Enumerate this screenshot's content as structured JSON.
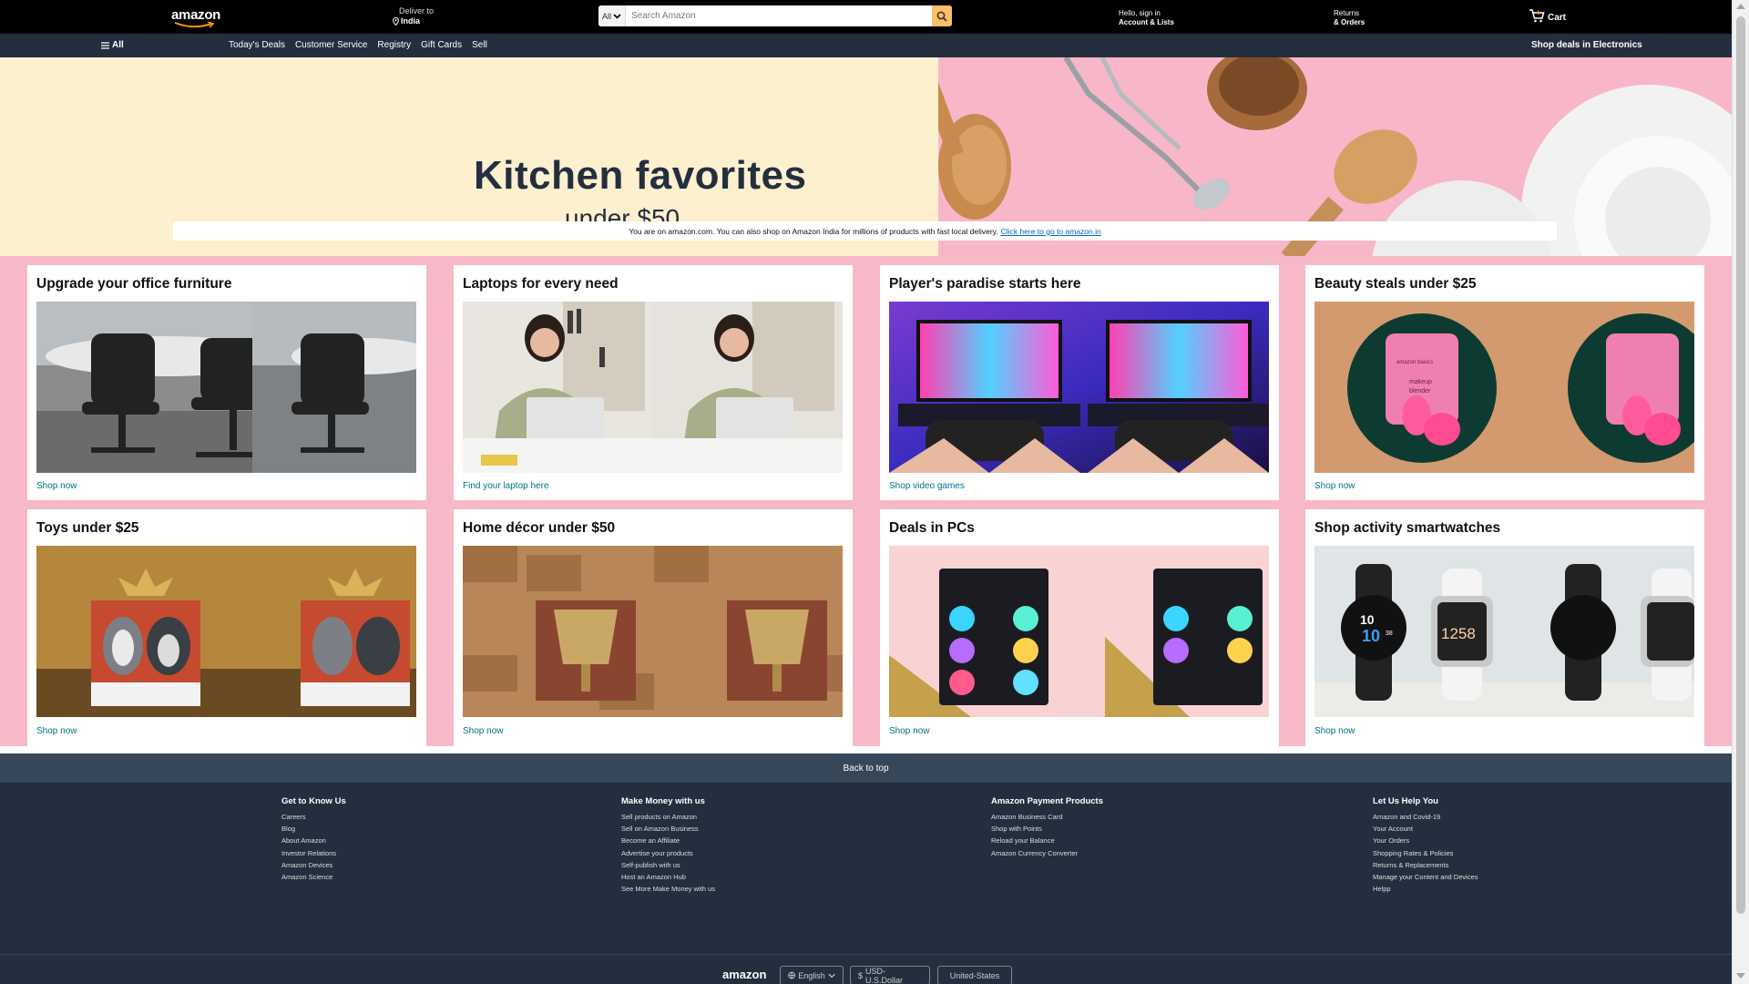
{
  "header": {
    "logo": "amazon",
    "deliver_line1": "Deliver to",
    "deliver_line2": "India",
    "search_category": "All",
    "search_placeholder": "Search Amazon",
    "account_line1": "Hello, sign in",
    "account_line2": "Account & Lists",
    "returns_line1": "Returns",
    "returns_line2": "& Orders",
    "cart_label": "Cart"
  },
  "subnav": {
    "all_label": "All",
    "links": [
      "Today's Deals",
      "Customer Service",
      "Registry",
      "Gift Cards",
      "Sell"
    ],
    "promo": "Shop deals in Electronics"
  },
  "hero": {
    "title": "Kitchen favorites",
    "subtitle": "under $50"
  },
  "notice": {
    "text": "You are on amazon.com. You can also shop on Amazon India for millions of products with fast local delivery.",
    "link": "Click here to go to amazon.in"
  },
  "cards": [
    {
      "title": "Upgrade your office furniture",
      "link": "Shop now"
    },
    {
      "title": "Laptops for every need",
      "link": "Find your laptop here"
    },
    {
      "title": "Player's paradise starts here",
      "link": "Shop video games"
    },
    {
      "title": "Beauty steals under $25",
      "link": "Shop now"
    },
    {
      "title": "Toys under $25",
      "link": "Shop now"
    },
    {
      "title": "Home décor under $50",
      "link": "Shop now"
    },
    {
      "title": "Deals in PCs",
      "link": "Shop now"
    },
    {
      "title": "Shop activity smartwatches",
      "link": "Shop now"
    }
  ],
  "image_text": {
    "beauty_brand": "amazon basics",
    "beauty_product_1": "makeup",
    "beauty_product_2": "blender",
    "watch_time_1": "10",
    "watch_time_2": "10",
    "watch_time_3": "38",
    "watch_digital": "1258"
  },
  "footer": {
    "back_to_top": "Back to top",
    "columns": [
      {
        "heading": "Get to Know Us",
        "items": [
          "Careers",
          "Blog",
          "About Amazon",
          "Investor Relations",
          "Amazon Devices",
          "Amazon Science"
        ]
      },
      {
        "heading": "Make Money with us",
        "items": [
          "Sell products on Amazon",
          "Sell on Amazon Business",
          "Become an Affiliate",
          "Advertise your products",
          "Self-publish with us",
          "Host an Amazon Hub",
          "See More Make Money with us"
        ]
      },
      {
        "heading": "Amazon Payment Products",
        "items": [
          "Amazon Business Card",
          "Shop with Points",
          "Reload your Balance",
          "Amazon Currency Converter"
        ]
      },
      {
        "heading": "Let Us Help You",
        "items": [
          "Amazon and Covid-19",
          "Your Account",
          "Your Orders",
          "Shopping Rates & Policies",
          "Returns & Replacements",
          "Manage your Content and Devices",
          "Helpp"
        ]
      }
    ],
    "bottom_logo": "amazon",
    "language": "English",
    "currency": "USD-U.S.Dollar",
    "country": "United-States"
  },
  "colors": {
    "nav_bg": "#000000",
    "subnav_bg": "#232f3e",
    "search_button": "#febd69",
    "hero_left": "#fdf0cf",
    "hero_right": "#f7b7c8",
    "content_bg": "#f7b8c8",
    "link": "#007185",
    "footer_bg": "#232f3e",
    "backtop_bg": "#37475a"
  },
  "icons": [
    "menu-icon",
    "location-pin-icon",
    "chevron-down-icon",
    "search-icon",
    "cart-icon",
    "globe-icon"
  ]
}
